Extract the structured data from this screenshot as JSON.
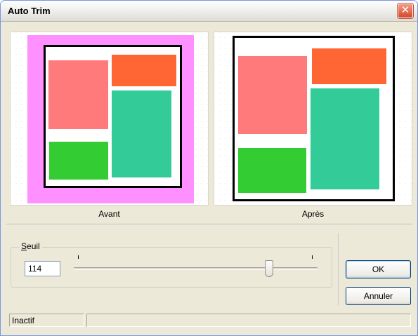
{
  "window": {
    "title": "Auto Trim",
    "close_symbol": "✕"
  },
  "previews": {
    "before_caption": "Avant",
    "after_caption": "Après",
    "colors": {
      "background_fill": "#ff90ff",
      "salmon": "#ff7a7a",
      "orange": "#ff6633",
      "teal": "#33cc99",
      "green": "#33cc33"
    }
  },
  "threshold": {
    "label_accel": "S",
    "label_rest": "euil",
    "value": "114",
    "slider_fraction": 0.8
  },
  "buttons": {
    "ok": "OK",
    "cancel": "Annuler"
  },
  "status": {
    "text": "Inactif",
    "secondary": ""
  }
}
